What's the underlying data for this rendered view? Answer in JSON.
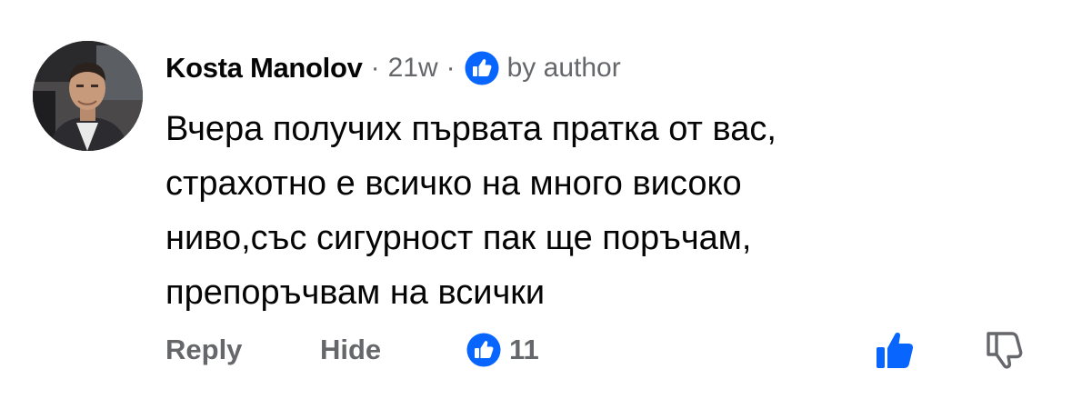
{
  "comment": {
    "author": "Kosta Manolov",
    "separator": "·",
    "time": "21w",
    "badge_label": "by author",
    "text_lines": [
      "Вчера получих първата пратка от вас,",
      "страхотно е всичко на много високо",
      "ниво,със сигурност пак ще поръчам,",
      "препоръчвам на всички"
    ]
  },
  "actions": {
    "reply_label": "Reply",
    "hide_label": "Hide",
    "reaction_count": "11"
  },
  "icons": {
    "badge": "thumbs-up-circle-icon",
    "reaction": "thumbs-up-circle-icon",
    "like": "thumbs-up-icon",
    "dislike": "thumbs-down-icon"
  },
  "colors": {
    "accent": "#0866ff",
    "secondary_text": "#65676b",
    "primary_text": "#050505"
  }
}
